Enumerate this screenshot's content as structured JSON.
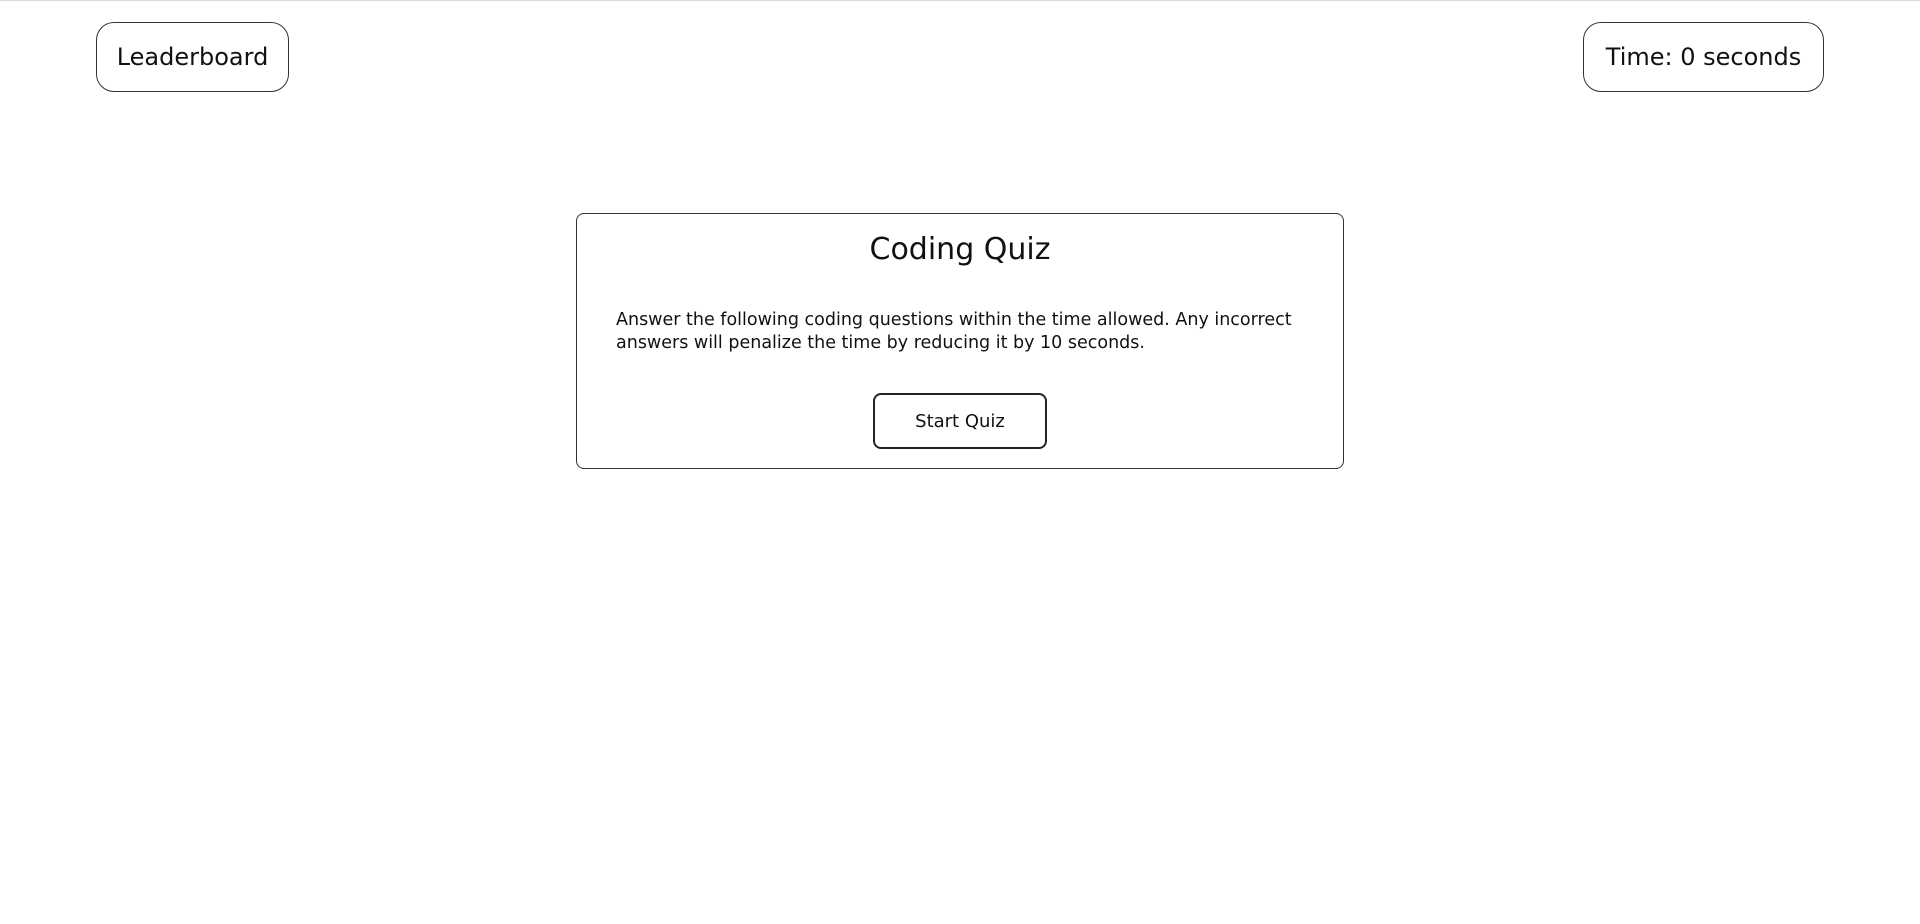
{
  "header": {
    "leaderboard_label": "Leaderboard",
    "timer_text": "Time: 0 seconds"
  },
  "card": {
    "title": "Coding Quiz",
    "instructions": "Answer the following coding questions within the time allowed. Any incorrect answers will penalize the time by reducing it by 10 seconds.",
    "start_label": "Start Quiz"
  },
  "colors": {
    "background": "#ffffff",
    "border": "#333333",
    "text": "#111111"
  }
}
